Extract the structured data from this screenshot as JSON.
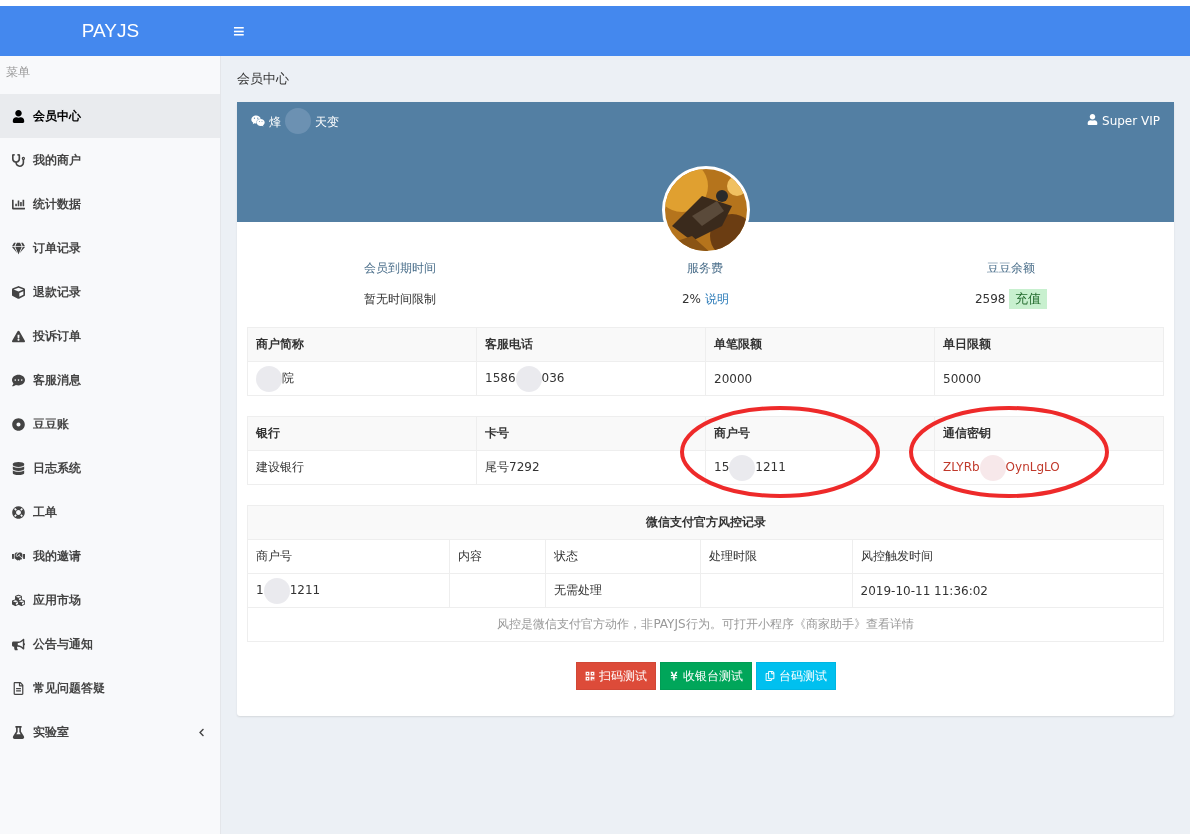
{
  "header": {
    "brand": "PAYJS",
    "menu_toggle": "≡"
  },
  "sidebar": {
    "heading": "菜单",
    "items": [
      {
        "label": "会员中心",
        "selected": true,
        "kind": "link"
      },
      {
        "label": "我的商户",
        "selected": false,
        "kind": "link"
      },
      {
        "label": "统计数据",
        "selected": false,
        "kind": "link"
      },
      {
        "label": "订单记录",
        "selected": false,
        "kind": "link"
      },
      {
        "label": "退款记录",
        "selected": false,
        "kind": "link"
      },
      {
        "label": "投诉订单",
        "selected": false,
        "kind": "link"
      },
      {
        "label": "客服消息",
        "selected": false,
        "kind": "link"
      },
      {
        "label": "豆豆账",
        "selected": false,
        "kind": "link"
      },
      {
        "label": "日志系统",
        "selected": false,
        "kind": "link"
      },
      {
        "label": "工单",
        "selected": false,
        "kind": "link"
      },
      {
        "label": "我的邀请",
        "selected": false,
        "kind": "link"
      },
      {
        "label": "应用市场",
        "selected": false,
        "kind": "link"
      },
      {
        "label": "公告与通知",
        "selected": false,
        "kind": "link"
      },
      {
        "label": "常见问题答疑",
        "selected": false,
        "kind": "link"
      },
      {
        "label": "实验室",
        "selected": false,
        "kind": "group"
      }
    ]
  },
  "breadcrumb": "会员中心",
  "profile": {
    "name_parts": [
      "烽",
      "天变"
    ],
    "level": "Super VIP",
    "avatar": {
      "kind": "picture"
    },
    "stats": [
      {
        "label": "会员到期时间",
        "value": "暂无时间限制",
        "kind": "plain"
      },
      {
        "label": "服务费",
        "value": "2%",
        "action": "说明",
        "kind": "link"
      },
      {
        "label": "豆豆余额",
        "value": "2598",
        "action": "充值",
        "kind": "badge"
      }
    ]
  },
  "merchant_table": {
    "columns": [
      {
        "label": "商户简称"
      },
      {
        "label": "客服电话"
      },
      {
        "label": "单笔限额"
      },
      {
        "label": "单日限额"
      }
    ],
    "rows": [
      [
        {
          "parts": [
            "院"
          ],
          "lead_mask": true
        },
        {
          "parts": [
            "1586",
            "036"
          ]
        },
        {
          "parts": [
            "20000"
          ]
        },
        {
          "parts": [
            "50000"
          ]
        }
      ]
    ]
  },
  "bank_table": {
    "columns": [
      {
        "label": "银行",
        "circled": false
      },
      {
        "label": "卡号",
        "circled": false
      },
      {
        "label": "商户号",
        "circled": true
      },
      {
        "label": "通信密钥",
        "circled": true
      }
    ],
    "rows": [
      [
        {
          "parts": [
            "建设银行"
          ],
          "secret": false
        },
        {
          "parts": [
            "尾号7292"
          ],
          "secret": false
        },
        {
          "parts": [
            "15",
            "1211"
          ],
          "secret": false
        },
        {
          "parts": [
            "ZLYRb",
            "OynLgLO"
          ],
          "secret": true
        }
      ]
    ]
  },
  "risk_table": {
    "title": "微信支付官方风控记录",
    "columns": [
      "商户号",
      "内容",
      "状态",
      "处理时限",
      "风控触发时间"
    ],
    "rows": [
      [
        {
          "parts": [
            "1",
            "1211"
          ]
        },
        {},
        {
          "parts": [
            "无需处理"
          ]
        },
        {},
        {
          "parts": [
            "2019-10-11 11:36:02"
          ]
        }
      ]
    ],
    "note": "风控是微信支付官方动作，非PAYJS行为。可打开小程序《商家助手》查看详情"
  },
  "buttons": [
    {
      "label": "扫码测试",
      "kind": "danger"
    },
    {
      "label": "收银台测试",
      "kind": "success"
    },
    {
      "label": "台码测试",
      "kind": "info"
    }
  ]
}
